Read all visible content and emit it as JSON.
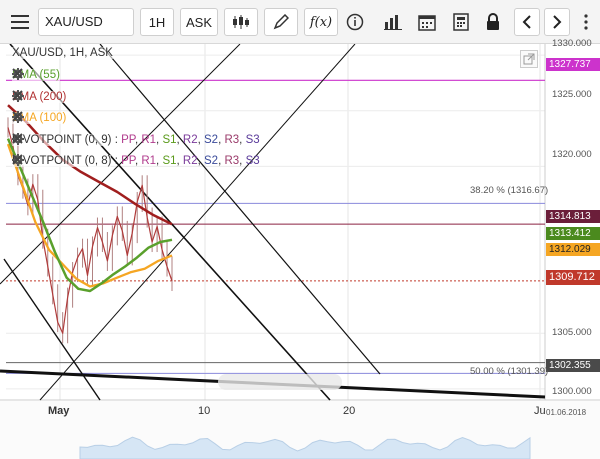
{
  "toolbar": {
    "menu_icon": "hamburger-menu-icon",
    "symbol": "XAU/USD",
    "timeframe": "1H",
    "price_side": "ASK",
    "chart_type_icon": "candlestick-icon",
    "draw_icon": "pencil-icon",
    "indicator_label": "f(x)",
    "info_icon": "info-icon",
    "volume_icon": "bar-chart-icon",
    "calendar_icon": "calendar-icon",
    "calculator_icon": "calculator-icon",
    "lock_icon": "lock-icon",
    "prev_icon": "chevron-left-icon",
    "next_icon": "chevron-right-icon"
  },
  "legend": {
    "title": "XAU/USD, 1H, ASK",
    "sma55": "SMA (55)",
    "sma200": "SMA (200)",
    "sma100": "SMA (100)",
    "pivot1_name": "PIVOTPOINT (0, 9)",
    "pivot2_name": "PIVOTPOINT (0, 8)",
    "pivot_sep": ":",
    "pp": "PP",
    "r1": "R1",
    "s1": "S1",
    "r2": "R2",
    "s2": "S2",
    "r3": "R3",
    "s3": "S3"
  },
  "colors": {
    "sma55": "#5aa02c",
    "sma200": "#a01e1e",
    "sma100": "#f5a623",
    "price_line": "#b03a3a",
    "magenta_line": "#cc33cc",
    "fib_line": "#8a8adb",
    "current_tag": "#c0392b"
  },
  "price_tags": {
    "magenta": "1327.737",
    "sma200": "1314.813",
    "sma55": "1313.412",
    "sma100": "1312.029",
    "current": "1309.712",
    "bottom": "1302.355"
  },
  "fib": {
    "f38": "38.20 % (1316.67)",
    "f50": "50.00 % (1301.39)"
  },
  "axis": {
    "y": [
      "1330.000",
      "1325.000",
      "1320.000",
      "1305.000",
      "1300.000"
    ],
    "x": [
      "May",
      "10",
      "20",
      "Ju"
    ],
    "date_stamp": "01.06.2018"
  },
  "chart_data": {
    "type": "line",
    "title": "XAU/USD, 1H, ASK",
    "ylim": [
      1299,
      1331
    ],
    "yticks": [
      1300,
      1305,
      1320,
      1325,
      1330
    ],
    "xticks": [
      "May",
      "10",
      "20",
      "Ju"
    ],
    "series": [
      {
        "name": "XAU/USD",
        "values": [
          1323.5,
          1321.8,
          1319.2,
          1318.0,
          1316.5,
          1318.4,
          1317.0,
          1313.5,
          1311.0,
          1308.5,
          1306.0,
          1305.0,
          1308.2,
          1310.5,
          1311.8,
          1312.6,
          1310.2,
          1312.8,
          1314.5,
          1313.2,
          1311.5,
          1313.8,
          1315.5,
          1314.2,
          1312.0,
          1314.0,
          1316.8,
          1318.3,
          1315.4,
          1313.2,
          1314.6,
          1312.5,
          1311.0,
          1309.7
        ]
      },
      {
        "name": "SMA (55)",
        "values": [
          1322.5,
          1320.0,
          1317.5,
          1315.0,
          1312.3,
          1310.0,
          1309.0,
          1308.8,
          1309.5,
          1310.3,
          1311.0,
          1311.8,
          1312.7,
          1313.2,
          1313.4
        ]
      },
      {
        "name": "SMA (200)",
        "values": [
          1325.5,
          1324.0,
          1322.2,
          1320.6,
          1319.5,
          1318.6,
          1317.7,
          1316.6,
          1315.6,
          1314.8
        ]
      },
      {
        "name": "SMA (100)",
        "values": [
          1322.0,
          1318.5,
          1315.0,
          1312.5,
          1311.2,
          1309.9,
          1309.2,
          1309.5,
          1310.0,
          1310.5,
          1310.8,
          1311.5,
          1312.0
        ]
      }
    ],
    "levels": [
      {
        "label": "1327.737",
        "value": 1327.737
      },
      {
        "label": "38.20 % (1316.67)",
        "value": 1316.67
      },
      {
        "label": "1314.813",
        "value": 1314.813
      },
      {
        "label": "1309.712",
        "value": 1309.712
      },
      {
        "label": "1302.355",
        "value": 1302.355
      },
      {
        "label": "50.00 % (1301.39)",
        "value": 1301.39
      }
    ]
  }
}
